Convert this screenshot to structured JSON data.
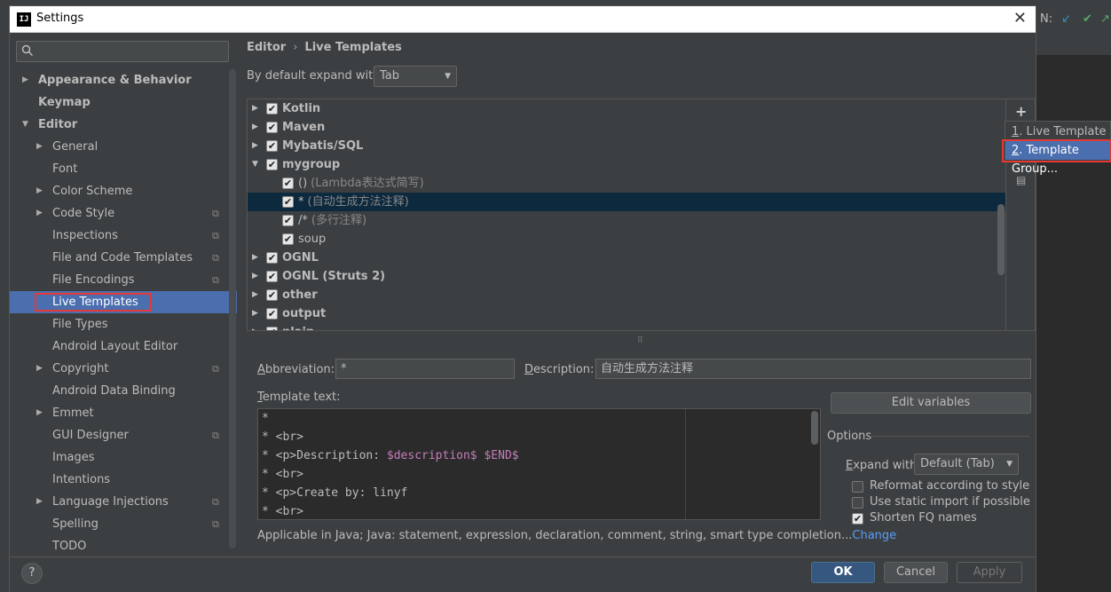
{
  "window": {
    "title": "Settings",
    "close_glyph": "✕",
    "app_icon": "IJ"
  },
  "background": {
    "toolbar_text": "N:",
    "vcs_update": "↙",
    "vcs_commit": "✔",
    "vcs_push": "↗"
  },
  "search": {
    "placeholder": "",
    "icon": "search-icon"
  },
  "sidebar": {
    "items": [
      {
        "label": "Appearance & Behavior",
        "bold": true,
        "arrow": "▶"
      },
      {
        "label": "Keymap",
        "bold": true,
        "arrow": ""
      },
      {
        "label": "Editor",
        "bold": true,
        "arrow": "▼"
      },
      {
        "label": "General",
        "arrow": "▶"
      },
      {
        "label": "Font",
        "arrow": ""
      },
      {
        "label": "Color Scheme",
        "arrow": "▶"
      },
      {
        "label": "Code Style",
        "arrow": "▶",
        "proj": true
      },
      {
        "label": "Inspections",
        "arrow": "",
        "proj": true
      },
      {
        "label": "File and Code Templates",
        "arrow": "",
        "proj": true
      },
      {
        "label": "File Encodings",
        "arrow": "",
        "proj": true
      },
      {
        "label": "Live Templates",
        "arrow": "",
        "selected": true
      },
      {
        "label": "File Types",
        "arrow": ""
      },
      {
        "label": "Android Layout Editor",
        "arrow": ""
      },
      {
        "label": "Copyright",
        "arrow": "▶",
        "proj": true
      },
      {
        "label": "Android Data Binding",
        "arrow": ""
      },
      {
        "label": "Emmet",
        "arrow": "▶"
      },
      {
        "label": "GUI Designer",
        "arrow": "",
        "proj": true
      },
      {
        "label": "Images",
        "arrow": ""
      },
      {
        "label": "Intentions",
        "arrow": ""
      },
      {
        "label": "Language Injections",
        "arrow": "▶",
        "proj": true
      },
      {
        "label": "Spelling",
        "arrow": "",
        "proj": true
      },
      {
        "label": "TODO",
        "arrow": ""
      }
    ],
    "proj_glyph": "⧉"
  },
  "breadcrumb": {
    "part1": "Editor",
    "separator": "›",
    "part2": "Live Templates"
  },
  "expand": {
    "label": "By default expand with",
    "value": "Tab",
    "caret": "▼"
  },
  "templates": {
    "rows": [
      {
        "arrow": "▶",
        "checked": "✔",
        "name": "Kotlin",
        "desc": "",
        "group": true
      },
      {
        "arrow": "▶",
        "checked": "✔",
        "name": "Maven",
        "desc": "",
        "group": true
      },
      {
        "arrow": "▶",
        "checked": "✔",
        "name": "Mybatis/SQL",
        "desc": "",
        "group": true
      },
      {
        "arrow": "▼",
        "checked": "✔",
        "name": "mygroup",
        "desc": "",
        "group": true
      },
      {
        "arrow": "",
        "checked": "✔",
        "name": "()",
        "desc": "(Lambda表达式简写)",
        "group": false
      },
      {
        "arrow": "",
        "checked": "✔",
        "name": "*",
        "desc": "(自动生成方法注释)",
        "group": false,
        "selected": true
      },
      {
        "arrow": "",
        "checked": "✔",
        "name": "/*",
        "desc": "(多行注释)",
        "group": false
      },
      {
        "arrow": "",
        "checked": "✔",
        "name": "soup",
        "desc": "",
        "group": false
      },
      {
        "arrow": "▶",
        "checked": "✔",
        "name": "OGNL",
        "desc": "",
        "group": true
      },
      {
        "arrow": "▶",
        "checked": "✔",
        "name": "OGNL (Struts 2)",
        "desc": "",
        "group": true
      },
      {
        "arrow": "▶",
        "checked": "✔",
        "name": "other",
        "desc": "",
        "group": true
      },
      {
        "arrow": "▶",
        "checked": "✔",
        "name": "output",
        "desc": "",
        "group": true
      },
      {
        "arrow": "▶",
        "checked": "✔",
        "name": "plain",
        "desc": "",
        "group": true
      }
    ]
  },
  "tools": {
    "add": "+",
    "doc": "▤"
  },
  "popup": {
    "items": [
      {
        "mnemonic": "1",
        "label": ". Live Template"
      },
      {
        "mnemonic": "2",
        "label": ". Template Group..."
      }
    ]
  },
  "splitter": "⠿",
  "abbreviation": {
    "label_m": "A",
    "label": "bbreviation:",
    "value": "*"
  },
  "description": {
    "label_m": "D",
    "label": "escription:",
    "value": "自动生成方法注释"
  },
  "template_text": {
    "label_m": "T",
    "label": "emplate text:",
    "lines": [
      {
        "pre": "*",
        "var": "",
        "post": ""
      },
      {
        "pre": "* <br>",
        "var": "",
        "post": ""
      },
      {
        "pre": "* <p>Description: ",
        "var": "$description$ $END$",
        "post": ""
      },
      {
        "pre": "* <br>",
        "var": "",
        "post": ""
      },
      {
        "pre": "* <p>Create by: linyf",
        "var": "",
        "post": ""
      },
      {
        "pre": "* <br>",
        "var": "",
        "post": ""
      }
    ]
  },
  "edit_variables": "Edit variables",
  "options": {
    "title": "Options",
    "expand_label_m": "E",
    "expand_label": "xpand with",
    "expand_value": "Default (Tab)",
    "checks": [
      {
        "label": "Reformat according to style",
        "checked": ""
      },
      {
        "label": "Use static import if possible",
        "checked": ""
      },
      {
        "label": "Shorten FQ names",
        "checked": "✔"
      }
    ]
  },
  "applicable": {
    "text": "Applicable in Java; Java: statement, expression, declaration, comment, string, smart type completion...",
    "link": "Change"
  },
  "footer": {
    "help": "?",
    "ok": "OK",
    "cancel": "Cancel",
    "apply": "Apply"
  }
}
